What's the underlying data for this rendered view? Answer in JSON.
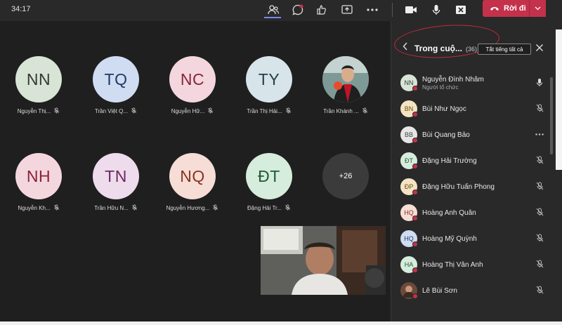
{
  "topbar": {
    "timer": "34:17",
    "leave_label": "Rời đi"
  },
  "grid": [
    {
      "initials": "NN",
      "name": "Nguyễn Thị...",
      "bg": "#d8e4d6",
      "fg": "#333a32"
    },
    {
      "initials": "TQ",
      "name": "Trần Việt Q...",
      "bg": "#cfdcf1",
      "fg": "#1f3b66"
    },
    {
      "initials": "NC",
      "name": "Nguyễn Hữ...",
      "bg": "#f4d7de",
      "fg": "#8a2437"
    },
    {
      "initials": "TY",
      "name": "Trần Thị Hải...",
      "bg": "#d7e4ea",
      "fg": "#263e4a"
    },
    {
      "initials": "",
      "name": "Trần Khánh ...",
      "photo": true
    },
    {
      "initials": "NH",
      "name": "Nguyễn Kh...",
      "bg": "#f4d7de",
      "fg": "#8a2437"
    },
    {
      "initials": "TN",
      "name": "Trần Hữu N...",
      "bg": "#eedbec",
      "fg": "#6b2a63"
    },
    {
      "initials": "NQ",
      "name": "Nguyễn Hương...",
      "bg": "#f6ddd6",
      "fg": "#8a3421"
    },
    {
      "initials": "ĐT",
      "name": "Đặng Hải Tr...",
      "bg": "#d6ecdd",
      "fg": "#1f5a34"
    }
  ],
  "more_count": "+26",
  "panel": {
    "title": "Trong cuộ...",
    "count": "(36)",
    "mute_all": "Tắt tiếng tất cả",
    "participants": [
      {
        "initials": "NN",
        "name": "Nguyễn Đình Nhâm",
        "sub": "Người tổ chức",
        "bg": "#d8e4d6",
        "fg": "#333a32",
        "action": "mic"
      },
      {
        "initials": "BN",
        "name": "Bùi Như Ngọc",
        "sub": "",
        "bg": "#f3e4c4",
        "fg": "#6b4b0e",
        "action": "mic-off"
      },
      {
        "initials": "BB",
        "name": "Bùi Quang Bảo",
        "sub": "",
        "bg": "#e5e5e5",
        "fg": "#444444",
        "action": "more"
      },
      {
        "initials": "ĐT",
        "name": "Đặng Hải Trường",
        "sub": "",
        "bg": "#d6ecdd",
        "fg": "#1f5a34",
        "action": "mic-off"
      },
      {
        "initials": "ĐP",
        "name": "Đặng Hữu Tuấn Phong",
        "sub": "",
        "bg": "#f3e4c4",
        "fg": "#6b4b0e",
        "action": "mic-off"
      },
      {
        "initials": "HQ",
        "name": "Hoàng Anh Quân",
        "sub": "",
        "bg": "#f6ddd6",
        "fg": "#8a3421",
        "action": "mic-off"
      },
      {
        "initials": "HQ",
        "name": "Hoàng Mỹ Quỳnh",
        "sub": "",
        "bg": "#cfdcf1",
        "fg": "#1f3b66",
        "action": "mic-off"
      },
      {
        "initials": "HA",
        "name": "Hoàng Thị Vân Anh",
        "sub": "",
        "bg": "#d6ecdd",
        "fg": "#1f5a34",
        "action": "mic-off"
      },
      {
        "initials": "",
        "name": "Lê Bùi Sơn",
        "sub": "",
        "photo": true,
        "action": "mic-off"
      }
    ]
  }
}
